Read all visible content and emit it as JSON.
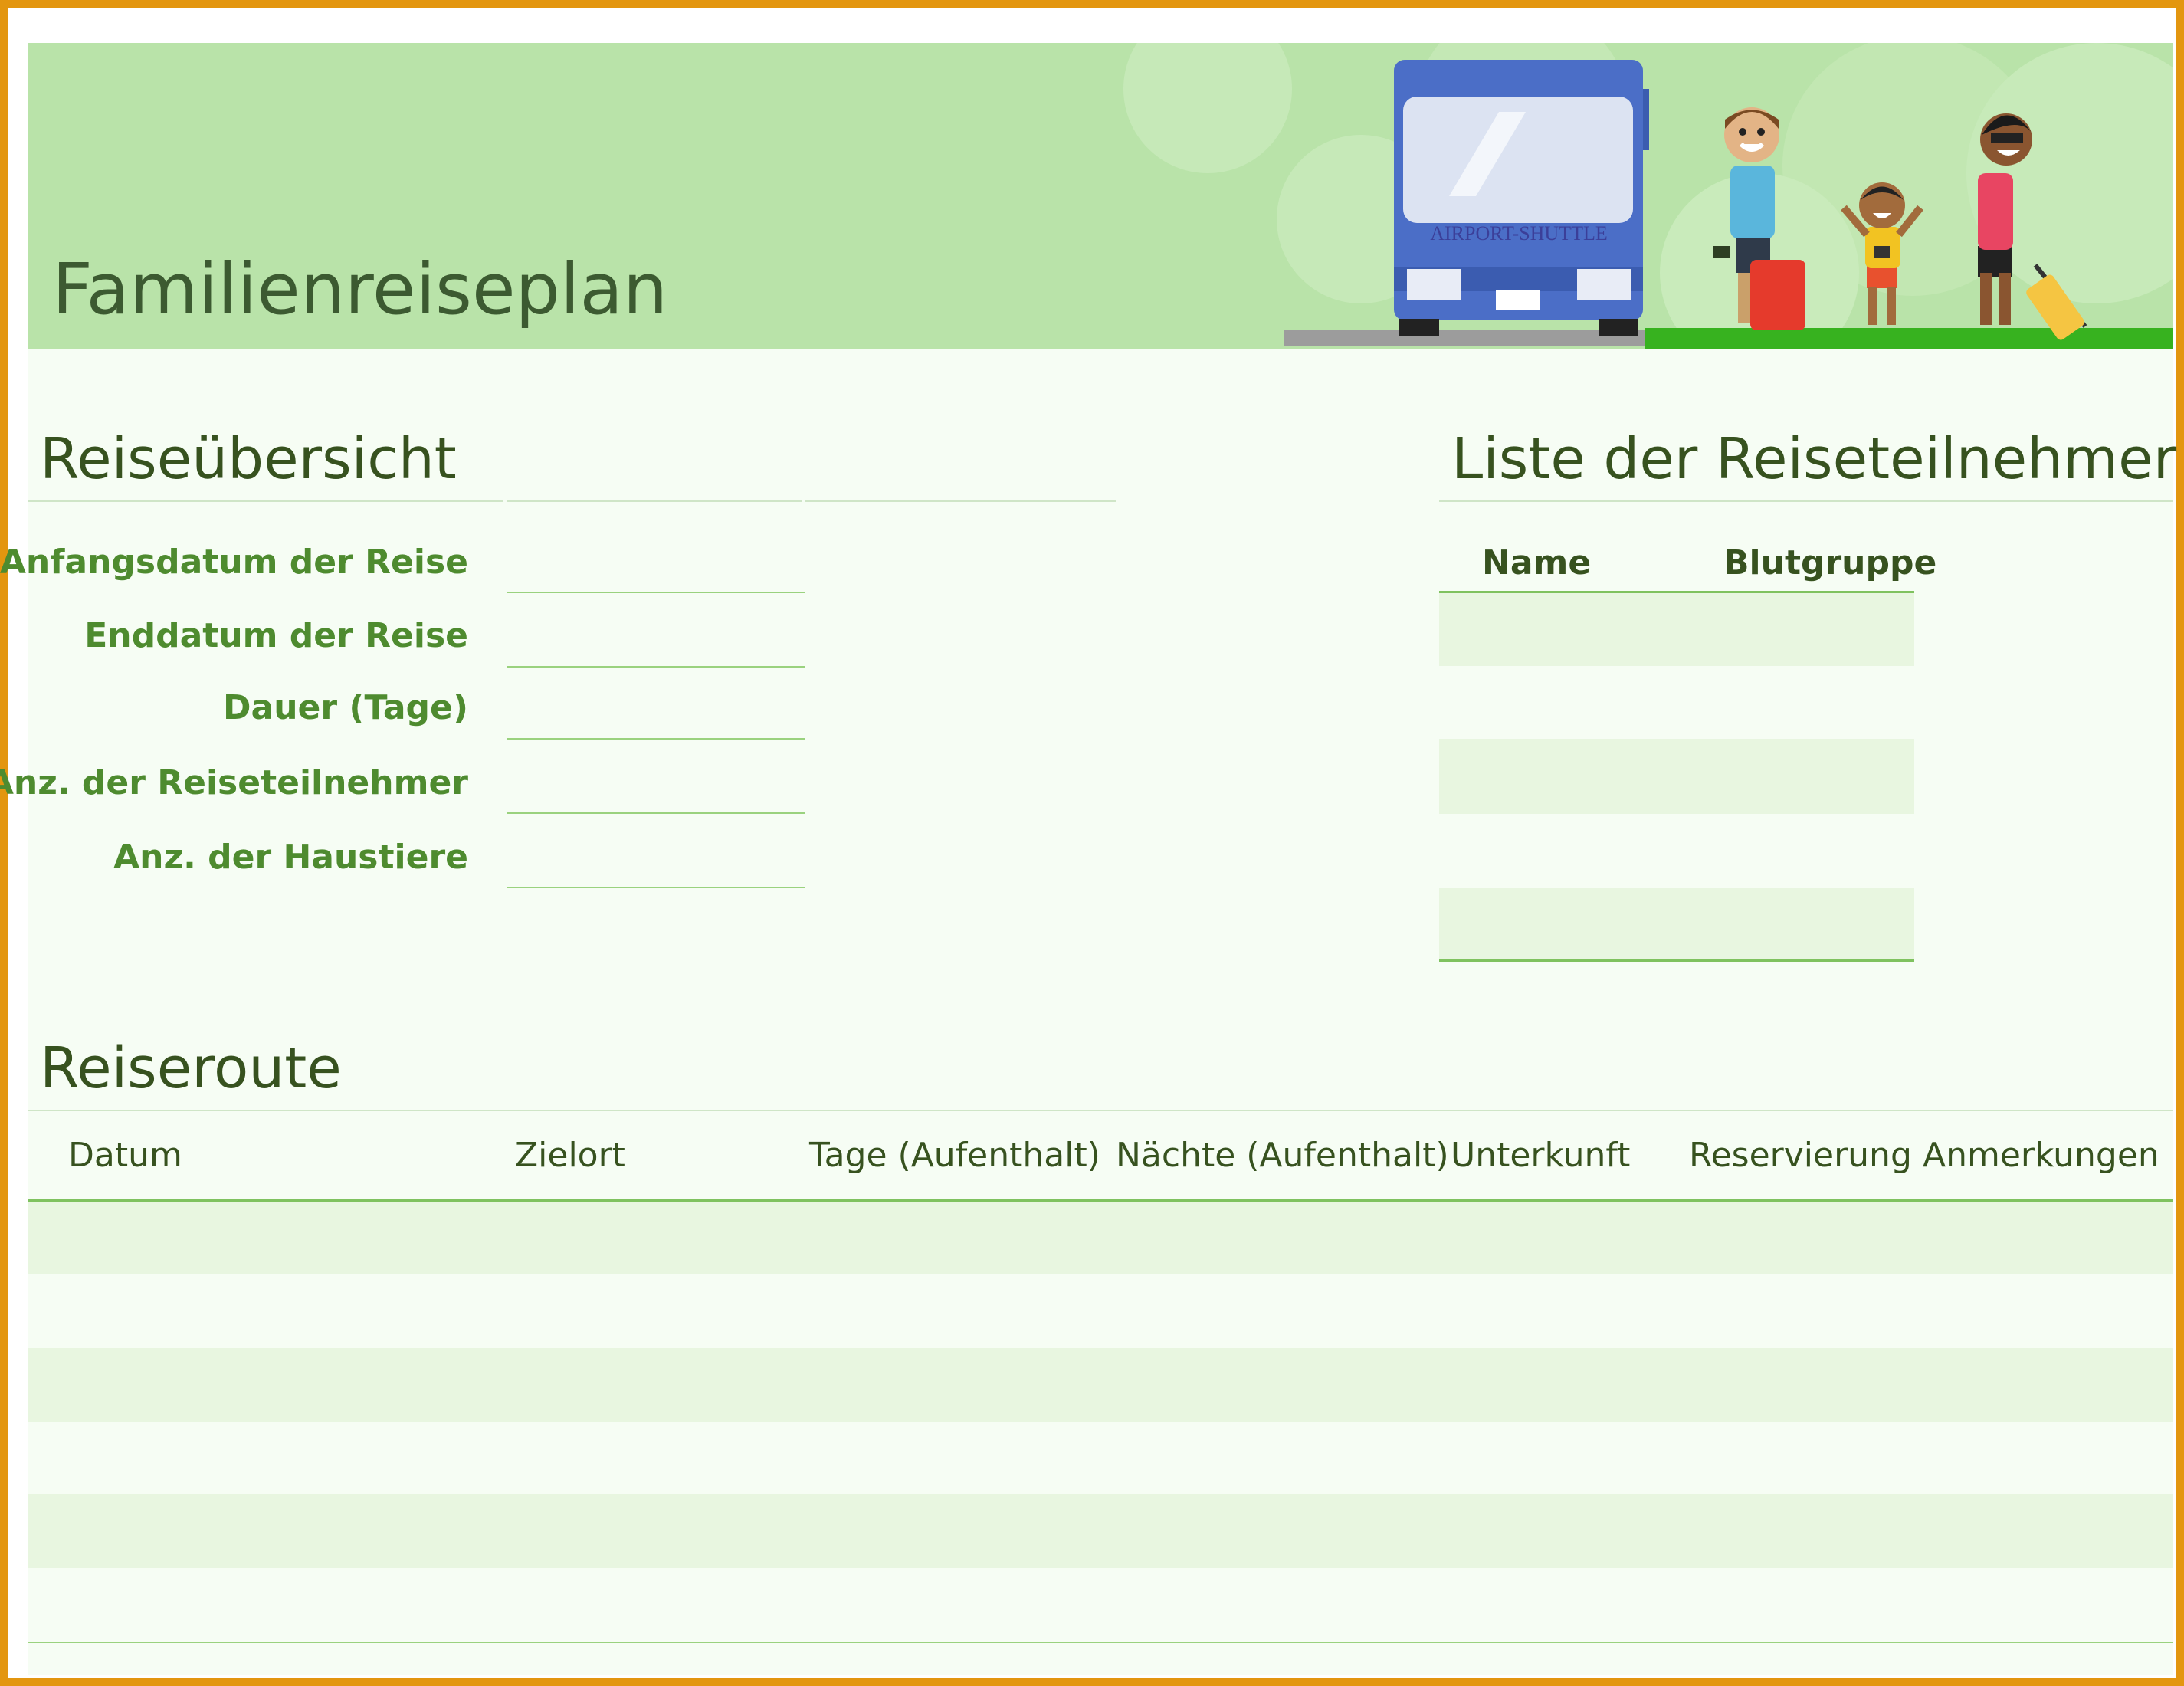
{
  "banner": {
    "title": "Familienreiseplan",
    "bus_sign": "AIRPORT-SHUTTLE"
  },
  "overview": {
    "heading": "Reiseübersicht",
    "fields": [
      {
        "label": "Anfangsdatum der Reise",
        "value": ""
      },
      {
        "label": "Enddatum der Reise",
        "value": ""
      },
      {
        "label": "Dauer (Tage)",
        "value": ""
      },
      {
        "label": "Anz. der Reiseteilnehmer",
        "value": ""
      },
      {
        "label": "Anz. der Haustiere",
        "value": ""
      }
    ]
  },
  "participants": {
    "heading": "Liste der Reiseteilnehmer",
    "columns": [
      "Name",
      "Blutgruppe"
    ],
    "rows": [
      [
        "",
        ""
      ],
      [
        "",
        ""
      ],
      [
        "",
        ""
      ],
      [
        "",
        ""
      ],
      [
        "",
        ""
      ]
    ]
  },
  "route": {
    "heading": "Reiseroute",
    "columns": [
      "Datum",
      "Zielort",
      "Tage (Aufenthalt)",
      "Nächte (Aufenthalt)",
      "Unterkunft",
      "Reservierung",
      "Anmerkungen"
    ],
    "rows": [
      [
        "",
        "",
        "",
        "",
        "",
        "",
        ""
      ],
      [
        "",
        "",
        "",
        "",
        "",
        "",
        ""
      ],
      [
        "",
        "",
        "",
        "",
        "",
        "",
        ""
      ],
      [
        "",
        "",
        "",
        "",
        "",
        "",
        ""
      ],
      [
        "",
        "",
        "",
        "",
        "",
        "",
        ""
      ],
      [
        "",
        "",
        "",
        "",
        "",
        "",
        ""
      ]
    ]
  },
  "colors": {
    "frame": "#e3960f",
    "banner": "#b9e3a9",
    "heading_text": "#37521f",
    "label_text": "#4e8b2f",
    "band": "#e8f6e0"
  }
}
